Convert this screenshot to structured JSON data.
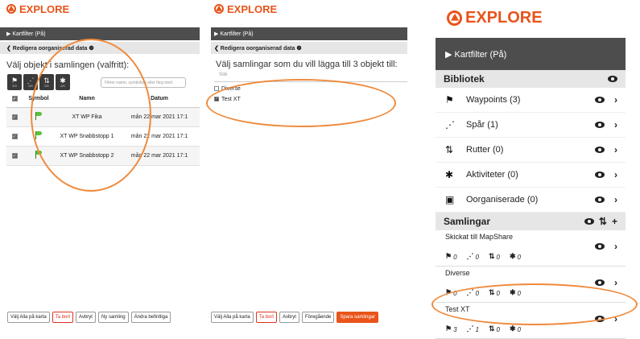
{
  "brand": "EXPLORE",
  "panel1": {
    "map_filter": "▶ Kartfilter (På)",
    "edit_unorganized": "❮ Redigera oorganiserad data ❷",
    "heading": "Välj objekt i samlingen (valfritt):",
    "toolbar": [
      {
        "icon": "flag-icon",
        "glyph": "⚑",
        "count": "3/3"
      },
      {
        "icon": "track-icon",
        "glyph": "⋰",
        "count": "0/0"
      },
      {
        "icon": "route-icon",
        "glyph": "⇅",
        "count": "0/0"
      },
      {
        "icon": "activity-icon",
        "glyph": "✱",
        "count": "0/0"
      }
    ],
    "filter_placeholder": "Filtrer namn, symboltyp eller färg med",
    "columns": {
      "symbol": "Symbol",
      "name": "Namn",
      "date": "Datum"
    },
    "rows": [
      {
        "name": "XT WP Fika",
        "date": "mån 22 mar 2021 17:1"
      },
      {
        "name": "XT WP Snabbstopp 1",
        "date": "mån 22 mar 2021 17:1"
      },
      {
        "name": "XT WP Snabbstopp 2",
        "date": "mån 22 mar 2021 17:1"
      }
    ],
    "buttons": {
      "show_all": "Välj Alla på karta",
      "delete": "Ta bort",
      "cancel": "Avbryt",
      "new_collection": "Ny samling",
      "change_existing": "Ändra befintliga"
    }
  },
  "panel2": {
    "map_filter": "▶ Kartfilter (På)",
    "edit_unorganized": "❮ Redigera oorganiserad data ❷",
    "heading": "Välj samlingar som du vill lägga till 3 objekt till:",
    "search_placeholder": "Sök",
    "collections": [
      {
        "name": "Diverse",
        "checked": false
      },
      {
        "name": "Test XT",
        "checked": true
      }
    ],
    "buttons": {
      "show_all": "Välj Alla på karta",
      "delete": "Ta bort",
      "cancel": "Avbryt",
      "previous": "Föregående",
      "save": "Spara samlingar"
    }
  },
  "panel3": {
    "map_filter": "▶ Kartfilter (På)",
    "library": "Bibliotek",
    "library_items": [
      {
        "icon": "flag-icon",
        "glyph": "⚑",
        "label": "Waypoints (3)"
      },
      {
        "icon": "track-icon",
        "glyph": "⋰",
        "label": "Spår (1)"
      },
      {
        "icon": "route-icon",
        "glyph": "⇅",
        "label": "Rutter (0)"
      },
      {
        "icon": "activity-icon",
        "glyph": "✱",
        "label": "Aktiviteter (0)"
      },
      {
        "icon": "briefcase-icon",
        "glyph": "▣",
        "label": "Oorganiserade (0)"
      }
    ],
    "collections_title": "Samlingar",
    "collections": [
      {
        "name": "Skickat till MapShare",
        "waypoints": "0",
        "tracks": "0",
        "routes": "0",
        "activities": "0"
      },
      {
        "name": "Diverse",
        "waypoints": "0",
        "tracks": "0",
        "routes": "0",
        "activities": "0"
      },
      {
        "name": "Test XT",
        "waypoints": "3",
        "tracks": "1",
        "routes": "0",
        "activities": "0"
      }
    ]
  },
  "colors": {
    "accent": "#e8541a",
    "annotation": "#ef8a3c",
    "dark_bar": "#4d4d4d"
  }
}
